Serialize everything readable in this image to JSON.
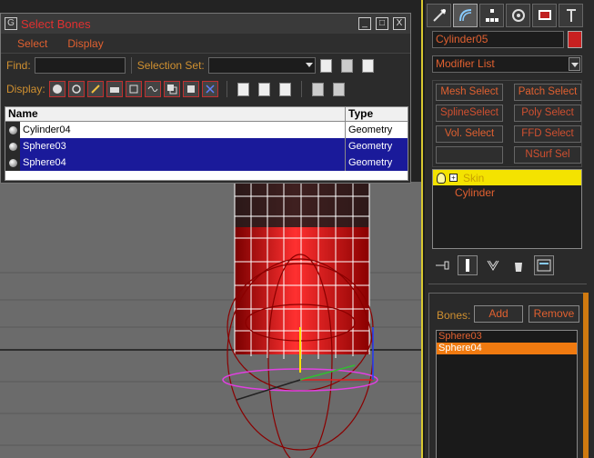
{
  "dialog": {
    "title": "Select Bones",
    "app_icon": "G",
    "win_buttons": [
      "_",
      "□",
      "X"
    ],
    "menu": [
      "Select",
      "Display"
    ],
    "find_label": "Find:",
    "find_value": "",
    "selection_set_label": "Selection Set:",
    "selection_set_value": "",
    "display_label": "Display:",
    "columns": [
      "Name",
      "Type"
    ],
    "rows": [
      {
        "name": "Cylinder04",
        "type": "Geometry",
        "selected": false
      },
      {
        "name": "Sphere03",
        "type": "Geometry",
        "selected": true
      },
      {
        "name": "Sphere04",
        "type": "Geometry",
        "selected": true
      }
    ]
  },
  "panel": {
    "tabs": [
      "create-icon",
      "modify-icon",
      "hierarchy-icon",
      "motion-icon",
      "display-icon",
      "utilities-icon"
    ],
    "object_name": "Cylinder05",
    "object_color": "#c82020",
    "modifier_list": "Modifier List",
    "modifier_buttons": [
      "Mesh Select",
      "Patch Select",
      "SplineSelect",
      "Poly Select",
      "Vol. Select",
      "FFD Select",
      "",
      "NSurf Sel"
    ],
    "stack": {
      "skin": "Skin",
      "base": "Cylinder"
    },
    "bones_label": "Bones:",
    "add_label": "Add",
    "remove_label": "Remove",
    "bones": [
      {
        "name": "Sphere03",
        "selected": false
      },
      {
        "name": "Sphere04",
        "selected": true
      }
    ]
  },
  "colors": {
    "accent_orange": "#e06030",
    "selection_blue": "#1a1a9a",
    "skin_yellow": "#f4e300"
  }
}
